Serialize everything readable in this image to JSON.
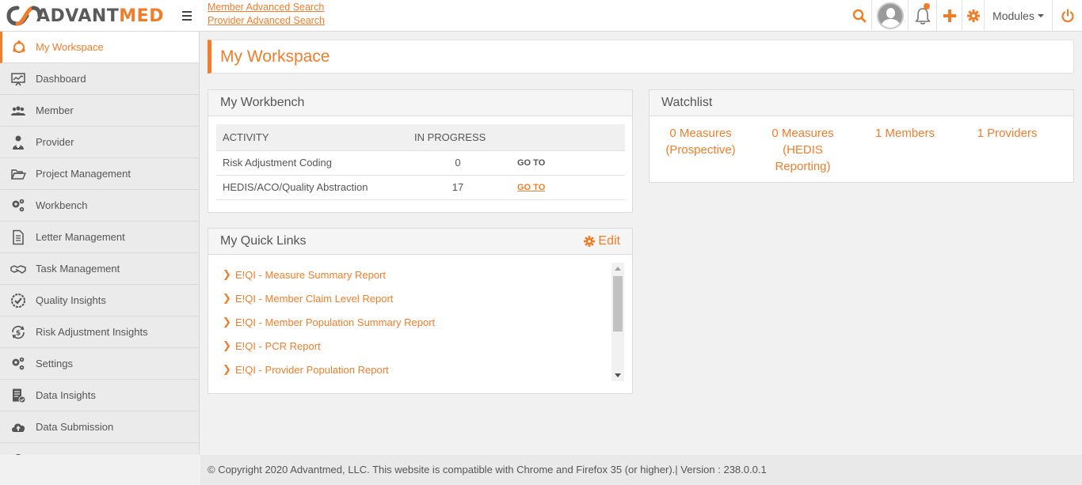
{
  "brand": {
    "name_part1": "ADVANT",
    "name_part2": "MED",
    "accent": "#f07d2a"
  },
  "header": {
    "links": [
      "Member Advanced Search",
      "Provider Advanced Search"
    ],
    "modules_label": "Modules",
    "icons": [
      "search-icon",
      "user-avatar-icon",
      "bell-icon",
      "plus-icon",
      "gear-icon",
      "power-icon"
    ],
    "notification_dot": true
  },
  "sidebar": {
    "items": [
      {
        "label": "My Workspace",
        "icon": "workspace-icon",
        "active": true
      },
      {
        "label": "Dashboard",
        "icon": "dashboard-icon"
      },
      {
        "label": "Member",
        "icon": "members-icon"
      },
      {
        "label": "Provider",
        "icon": "provider-icon"
      },
      {
        "label": "Project Management",
        "icon": "folder-open-icon"
      },
      {
        "label": "Workbench",
        "icon": "cogs-icon"
      },
      {
        "label": "Letter Management",
        "icon": "document-icon"
      },
      {
        "label": "Task Management",
        "icon": "handshake-icon"
      },
      {
        "label": "Quality Insights",
        "icon": "check-circle-icon"
      },
      {
        "label": "Risk Adjustment Insights",
        "icon": "dollar-cycle-icon"
      },
      {
        "label": "Settings",
        "icon": "cogs-icon"
      },
      {
        "label": "Data Insights",
        "icon": "report-icon"
      },
      {
        "label": "Data Submission",
        "icon": "cloud-upload-icon"
      }
    ]
  },
  "main": {
    "page_title": "My Workspace",
    "workbench": {
      "title": "My Workbench",
      "columns": [
        "ACTIVITY",
        "IN PROGRESS",
        ""
      ],
      "rows": [
        {
          "activity": "Risk Adjustment Coding",
          "in_progress": "0",
          "action": "GO TO"
        },
        {
          "activity": "HEDIS/ACO/Quality Abstraction",
          "in_progress": "17",
          "action": "GO TO"
        }
      ]
    },
    "quick_links": {
      "title": "My Quick Links",
      "edit_label": "Edit",
      "items": [
        "E!QI - Measure Summary Report",
        "E!QI - Member Claim Level Report",
        "E!QI - Member Population Summary Report",
        "E!QI - PCR Report",
        "E!QI - Provider Population Report"
      ]
    },
    "watchlist": {
      "title": "Watchlist",
      "items": [
        {
          "line1": "0 Measures",
          "line2": "(Prospective)",
          "line3": ""
        },
        {
          "line1": "0 Measures",
          "line2": "(HEDIS",
          "line3": "Reporting)"
        },
        {
          "line1": "1 Members",
          "line2": "",
          "line3": ""
        },
        {
          "line1": "1 Providers",
          "line2": "",
          "line3": ""
        }
      ]
    }
  },
  "footer": {
    "text": "© Copyright 2020 Advantmed, LLC. This website is compatible with Chrome and Firefox 35 (or higher).| Version : 238.0.0.1"
  }
}
